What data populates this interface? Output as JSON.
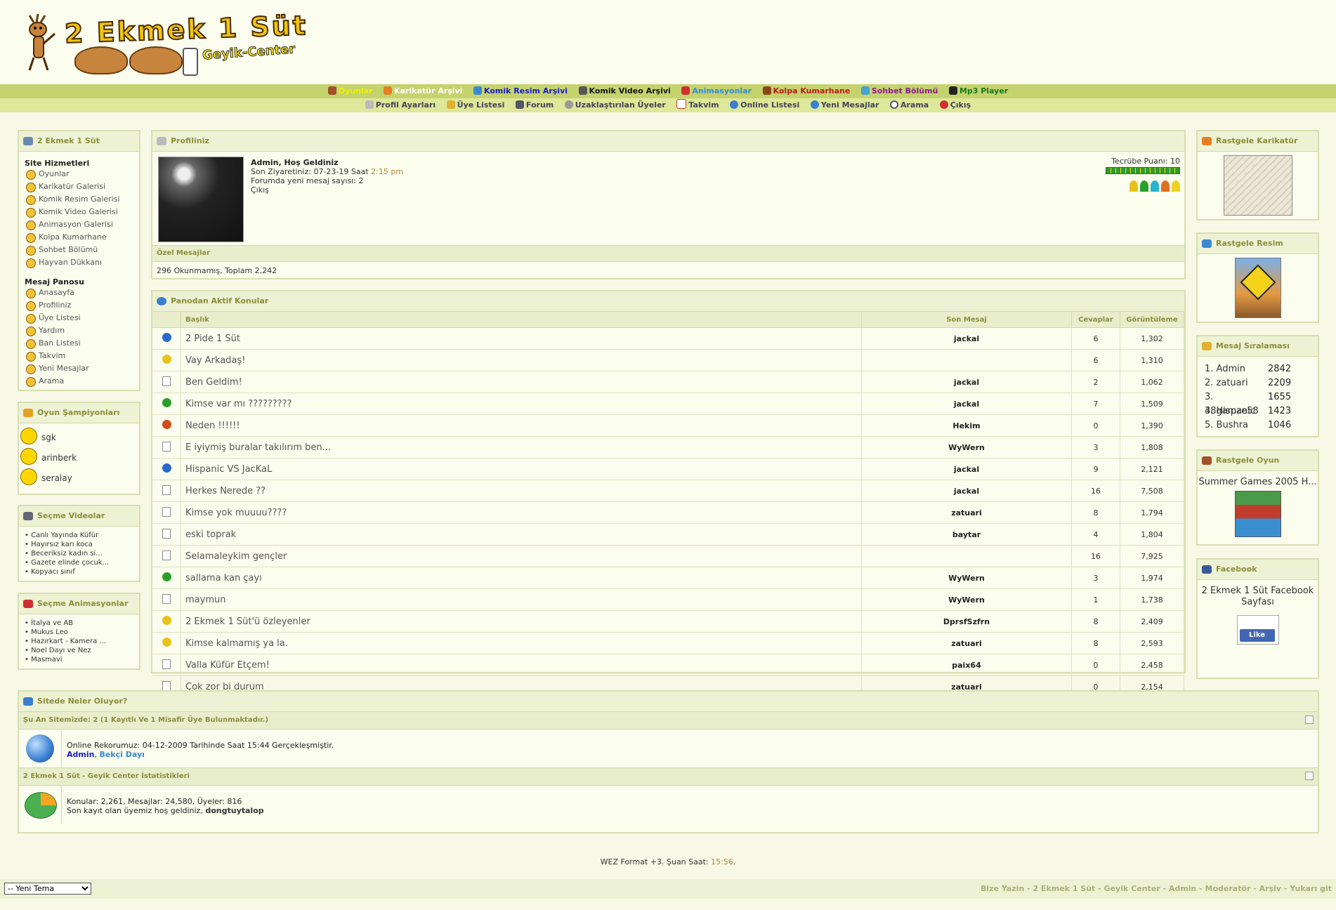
{
  "header": {
    "logo_title": "2 Ekmek 1 Süt",
    "logo_sub": "Geyik-Center"
  },
  "nav_main": [
    {
      "label": "Oyunlar",
      "color": "#f0f000"
    },
    {
      "label": "Karikatür Arşivi",
      "color": "#ffffff"
    },
    {
      "label": "Komik Resim Arşivi",
      "color": "#1a1acc"
    },
    {
      "label": "Komik Video Arşivi",
      "color": "#111111"
    },
    {
      "label": "Animasyonlar",
      "color": "#3a8ad0"
    },
    {
      "label": "Kolpa Kumarhane",
      "color": "#c01818"
    },
    {
      "label": "Sohbet Bölümü",
      "color": "#8a1a8a"
    },
    {
      "label": "Mp3 Player",
      "color": "#1a7a1a"
    }
  ],
  "nav_sub": [
    {
      "label": "Profil Ayarları"
    },
    {
      "label": "Üye Listesi"
    },
    {
      "label": "Forum"
    },
    {
      "label": "Uzaklaştırılan Üyeler"
    },
    {
      "label": "Takvim"
    },
    {
      "label": "Online Listesi"
    },
    {
      "label": "Yeni Mesajlar"
    },
    {
      "label": "Arama"
    },
    {
      "label": "Çıkış"
    }
  ],
  "left": {
    "site_box_title": "2 Ekmek 1 Süt",
    "site_services_title": "Site Hizmetleri",
    "site_services": [
      "Oyunlar",
      "Karikatür Galerisi",
      "Komik Resim Galerisi",
      "Komik Video Galerisi",
      "Animasyon Galerisi",
      "Kolpa Kumarhane",
      "Sohbet Bölümü",
      "Hayvan Dükkanı"
    ],
    "board_title": "Mesaj Panosu",
    "board_items": [
      "Anasayfa",
      "Profiliniz",
      "Üye Listesi",
      "Yardım",
      "Ban Listesi",
      "Takvim",
      "Yeni Mesajlar",
      "Arama"
    ],
    "champions_title": "Oyun Şampiyonları",
    "champions": [
      "sgk",
      "arinberk",
      "seralay"
    ],
    "videos_title": "Seçme Videolar",
    "videos": [
      "• Canlı Yayında Küfür",
      "• Hayırsız karı koca",
      "• Beceriksiz kadın si...",
      "• Gazete elinde çocuk...",
      "• Kopyacı sınıf"
    ],
    "anims_title": "Seçme Animasyonlar",
    "anims": [
      "• İtalya ve AB",
      "• Mukus Leo",
      "• Hazırkart - Kamera ...",
      "• Noel Dayı ve Nez",
      "• Masmavi"
    ]
  },
  "profile": {
    "title": "Profiliniz",
    "welcome": "Admin, Hoş Geldiniz",
    "last_visit_label": "Son Ziyaretiniz: 07-23-19 Saat",
    "last_visit_time": "2:15 pm",
    "new_messages": "Forumda yeni mesaj sayısı: 2",
    "logout": "Çıkış",
    "xp_label": "Tecrübe Puanı: 10",
    "pm_title": "Özel Mesajlar",
    "pm_text": "296 Okunmamış, Toplam 2,242"
  },
  "topics": {
    "title": "Panodan Aktif Konular",
    "headers": {
      "title": "Başlık",
      "last": "Son Mesaj",
      "replies": "Cevaplar",
      "views": "Görüntüleme"
    },
    "rows": [
      {
        "icon": "cool",
        "icon_color": "#2a6ad0",
        "title": "2 Pide 1 Süt",
        "last": "jackal",
        "replies": "6",
        "views": "1,302"
      },
      {
        "icon": "grin",
        "icon_color": "#e8c21a",
        "title": "Vay Arkadaş!",
        "last": "",
        "replies": "6",
        "views": "1,310"
      },
      {
        "icon": "doc",
        "icon_color": "#ffffff",
        "title": "Ben Geldim!",
        "last": "jackal",
        "replies": "2",
        "views": "1,062"
      },
      {
        "icon": "green",
        "icon_color": "#2aa02a",
        "title": "Kimse var mı ?????????",
        "last": "jackal",
        "replies": "7",
        "views": "1,509"
      },
      {
        "icon": "thumbdown",
        "icon_color": "#d04a1a",
        "title": "Neden !!!!!!",
        "last": "Hekim",
        "replies": "0",
        "views": "1,390"
      },
      {
        "icon": "doc",
        "icon_color": "#ffffff",
        "title": "E iyiymiş buralar takılırım ben...",
        "last": "WyWern",
        "replies": "3",
        "views": "1,808"
      },
      {
        "icon": "cool",
        "icon_color": "#2a6ad0",
        "title": "Hispanic VS JacKaL",
        "last": "jackal",
        "replies": "9",
        "views": "2,121"
      },
      {
        "icon": "doc",
        "icon_color": "#ffffff",
        "title": "Herkes Nerede ??",
        "last": "jackal",
        "replies": "16",
        "views": "7,508"
      },
      {
        "icon": "doc",
        "icon_color": "#ffffff",
        "title": "Kimse yok muuuu????",
        "last": "zatuari",
        "replies": "8",
        "views": "1,794"
      },
      {
        "icon": "doc",
        "icon_color": "#ffffff",
        "title": "eski toprak",
        "last": "baytar",
        "replies": "4",
        "views": "1,804"
      },
      {
        "icon": "doc",
        "icon_color": "#ffffff",
        "title": "Selamaleykim gençler",
        "last": "",
        "replies": "16",
        "views": "7,925"
      },
      {
        "icon": "green",
        "icon_color": "#2aa02a",
        "title": "sallama kan çayı",
        "last": "WyWern",
        "replies": "3",
        "views": "1,974"
      },
      {
        "icon": "doc",
        "icon_color": "#ffffff",
        "title": "maymun",
        "last": "WyWern",
        "replies": "1",
        "views": "1,738"
      },
      {
        "icon": "sunglasses",
        "icon_color": "#e8c21a",
        "title": "2 Ekmek 1 Süt'ü özleyenler",
        "last": "DprsfSzfrn",
        "replies": "8",
        "views": "2,409"
      },
      {
        "icon": "grin",
        "icon_color": "#e8c21a",
        "title": "Kimse kalmamış ya la.",
        "last": "zatuari",
        "replies": "8",
        "views": "2,593"
      },
      {
        "icon": "doc",
        "icon_color": "#ffffff",
        "title": "Valla Küfür Etçem!",
        "last": "paix64",
        "replies": "0",
        "views": "2,458"
      },
      {
        "icon": "doc",
        "icon_color": "#ffffff",
        "title": "Çok zor bi durum",
        "last": "zatuari",
        "replies": "0",
        "views": "2,154"
      }
    ]
  },
  "right": {
    "cartoon_title": "Rastgele Karikatür",
    "image_title": "Rastgele Resim",
    "ranking_title": "Mesaj Sıralaması",
    "ranking": [
      {
        "name": "1. Admin",
        "count": "2842"
      },
      {
        "name": "2. zatuari",
        "count": "2209"
      },
      {
        "name": "3. 38gamze58",
        "count": "1655"
      },
      {
        "name": "4. Hispanic",
        "count": "1423"
      },
      {
        "name": "5. Bushra",
        "count": "1046"
      }
    ],
    "game_title": "Rastgele Oyun",
    "game_name": "Summer Games 2005 H...",
    "facebook_title": "Facebook",
    "facebook_text": "2 Ekmek 1 Süt Facebook Sayfası",
    "like": "Like"
  },
  "whats": {
    "title": "Sitede Neler Oluyor?",
    "online_head": "Şu An Sitemizde: 2 (1 Kayıtlı Ve 1 Misafir Üye Bulunmaktadır.)",
    "online_record": "Online Rekorumuz: 04-12-2009 Tarihinde Saat 15:44 Gerçekleşmiştir.",
    "online_user1": "Admin",
    "online_sep": ", ",
    "online_user2": "Bekçi Dayı",
    "stats_head": "2 Ekmek 1 Süt - Geyik Center İstatistikleri",
    "stats_line": "Konular: 2,261, Mesajlar: 24,580, Üyeler: 816",
    "newest_label": "Son kayıt olan üyemiz hoş geldiniz,",
    "newest_user": "dongtuytalop"
  },
  "footer": {
    "time_label": "WEZ Format +3. Şuan Saat:",
    "time_value": "15:56",
    "time_end": ".",
    "theme_value": "-- Yeni Tema",
    "links": "Bize Yazin - 2 Ekmek 1 Süt - Geyik Center - Admin - Moderatör - Arşiv - Yukarı git"
  }
}
